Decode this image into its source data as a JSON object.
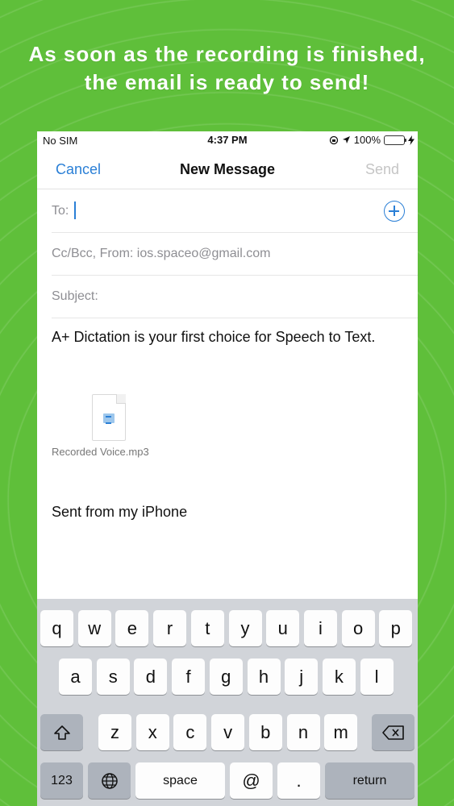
{
  "headline": {
    "line1": "As soon as the recording is finished,",
    "line2": "the email is ready to send!"
  },
  "statusbar": {
    "carrier": "No SIM",
    "time": "4:37 PM",
    "battery": "100%",
    "icons": [
      "orientation-lock-icon",
      "location-arrow-icon",
      "battery-icon",
      "charging-bolt-icon"
    ]
  },
  "navbar": {
    "cancel": "Cancel",
    "title": "New Message",
    "send": "Send"
  },
  "fields": {
    "to_label": "To:",
    "ccbcc_label": "Cc/Bcc, From:  ios.spaceo@gmail.com",
    "subject_label": "Subject:"
  },
  "message": {
    "body": "A+ Dictation is your first choice for Speech to Text.",
    "attachment_name": "Recorded Voice.mp3",
    "signature": "Sent from my iPhone"
  },
  "keyboard": {
    "row1": [
      "q",
      "w",
      "e",
      "r",
      "t",
      "y",
      "u",
      "i",
      "o",
      "p"
    ],
    "row2": [
      "a",
      "s",
      "d",
      "f",
      "g",
      "h",
      "j",
      "k",
      "l"
    ],
    "row3": [
      "z",
      "x",
      "c",
      "v",
      "b",
      "n",
      "m"
    ],
    "numbers": "123",
    "space": "space",
    "at": "@",
    "period": ".",
    "return": "return"
  },
  "colors": {
    "background": "#5fbf3a",
    "accent": "#2a7fd6",
    "battery": "#4cd964"
  }
}
